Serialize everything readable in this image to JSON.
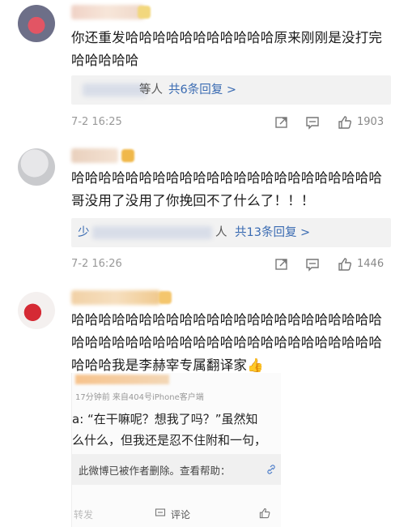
{
  "comments": [
    {
      "text": "你还重发哈哈哈哈哈哈哈哈哈哈哈原来刚刚是没打完哈哈哈哈哈",
      "reply_prefix": "",
      "reply_person_suffix": "等人",
      "reply_link": "共6条回复 >",
      "time": "7-2 16:25",
      "likes": "1903"
    },
    {
      "text": "哈哈哈哈哈哈哈哈哈哈哈哈哈哈哈哈哈哈哈哈哈哈哈哥没用了没用了你挽回不了什么了！！！",
      "reply_prefix": "少",
      "reply_person_suffix": "人",
      "reply_link": "共13条回复 >",
      "time": "7-2 16:26",
      "likes": "1446"
    },
    {
      "text": "哈哈哈哈哈哈哈哈哈哈哈哈哈哈哈哈哈哈哈哈哈哈哈哈哈哈哈哈哈哈哈哈哈哈哈哈哈哈哈哈哈哈哈哈哈哈哈哈哈我是李赫宰专属翻译家👍"
    }
  ],
  "embedded": {
    "source": "17分钟前  来自404号iPhone客户端",
    "line1": "a: “在干嘛呢？想我了吗？”虽然知",
    "line2": "么什么，但我还是忍不住附和一句，",
    "deleted_notice": "此微博已被作者删除。查看帮助：",
    "repost": "转发",
    "comment": "评论"
  },
  "icons": [
    "share-icon",
    "comment-icon",
    "thumbs-up-icon"
  ],
  "colors": {
    "link": "#3a6bb2",
    "meta": "#999999"
  }
}
